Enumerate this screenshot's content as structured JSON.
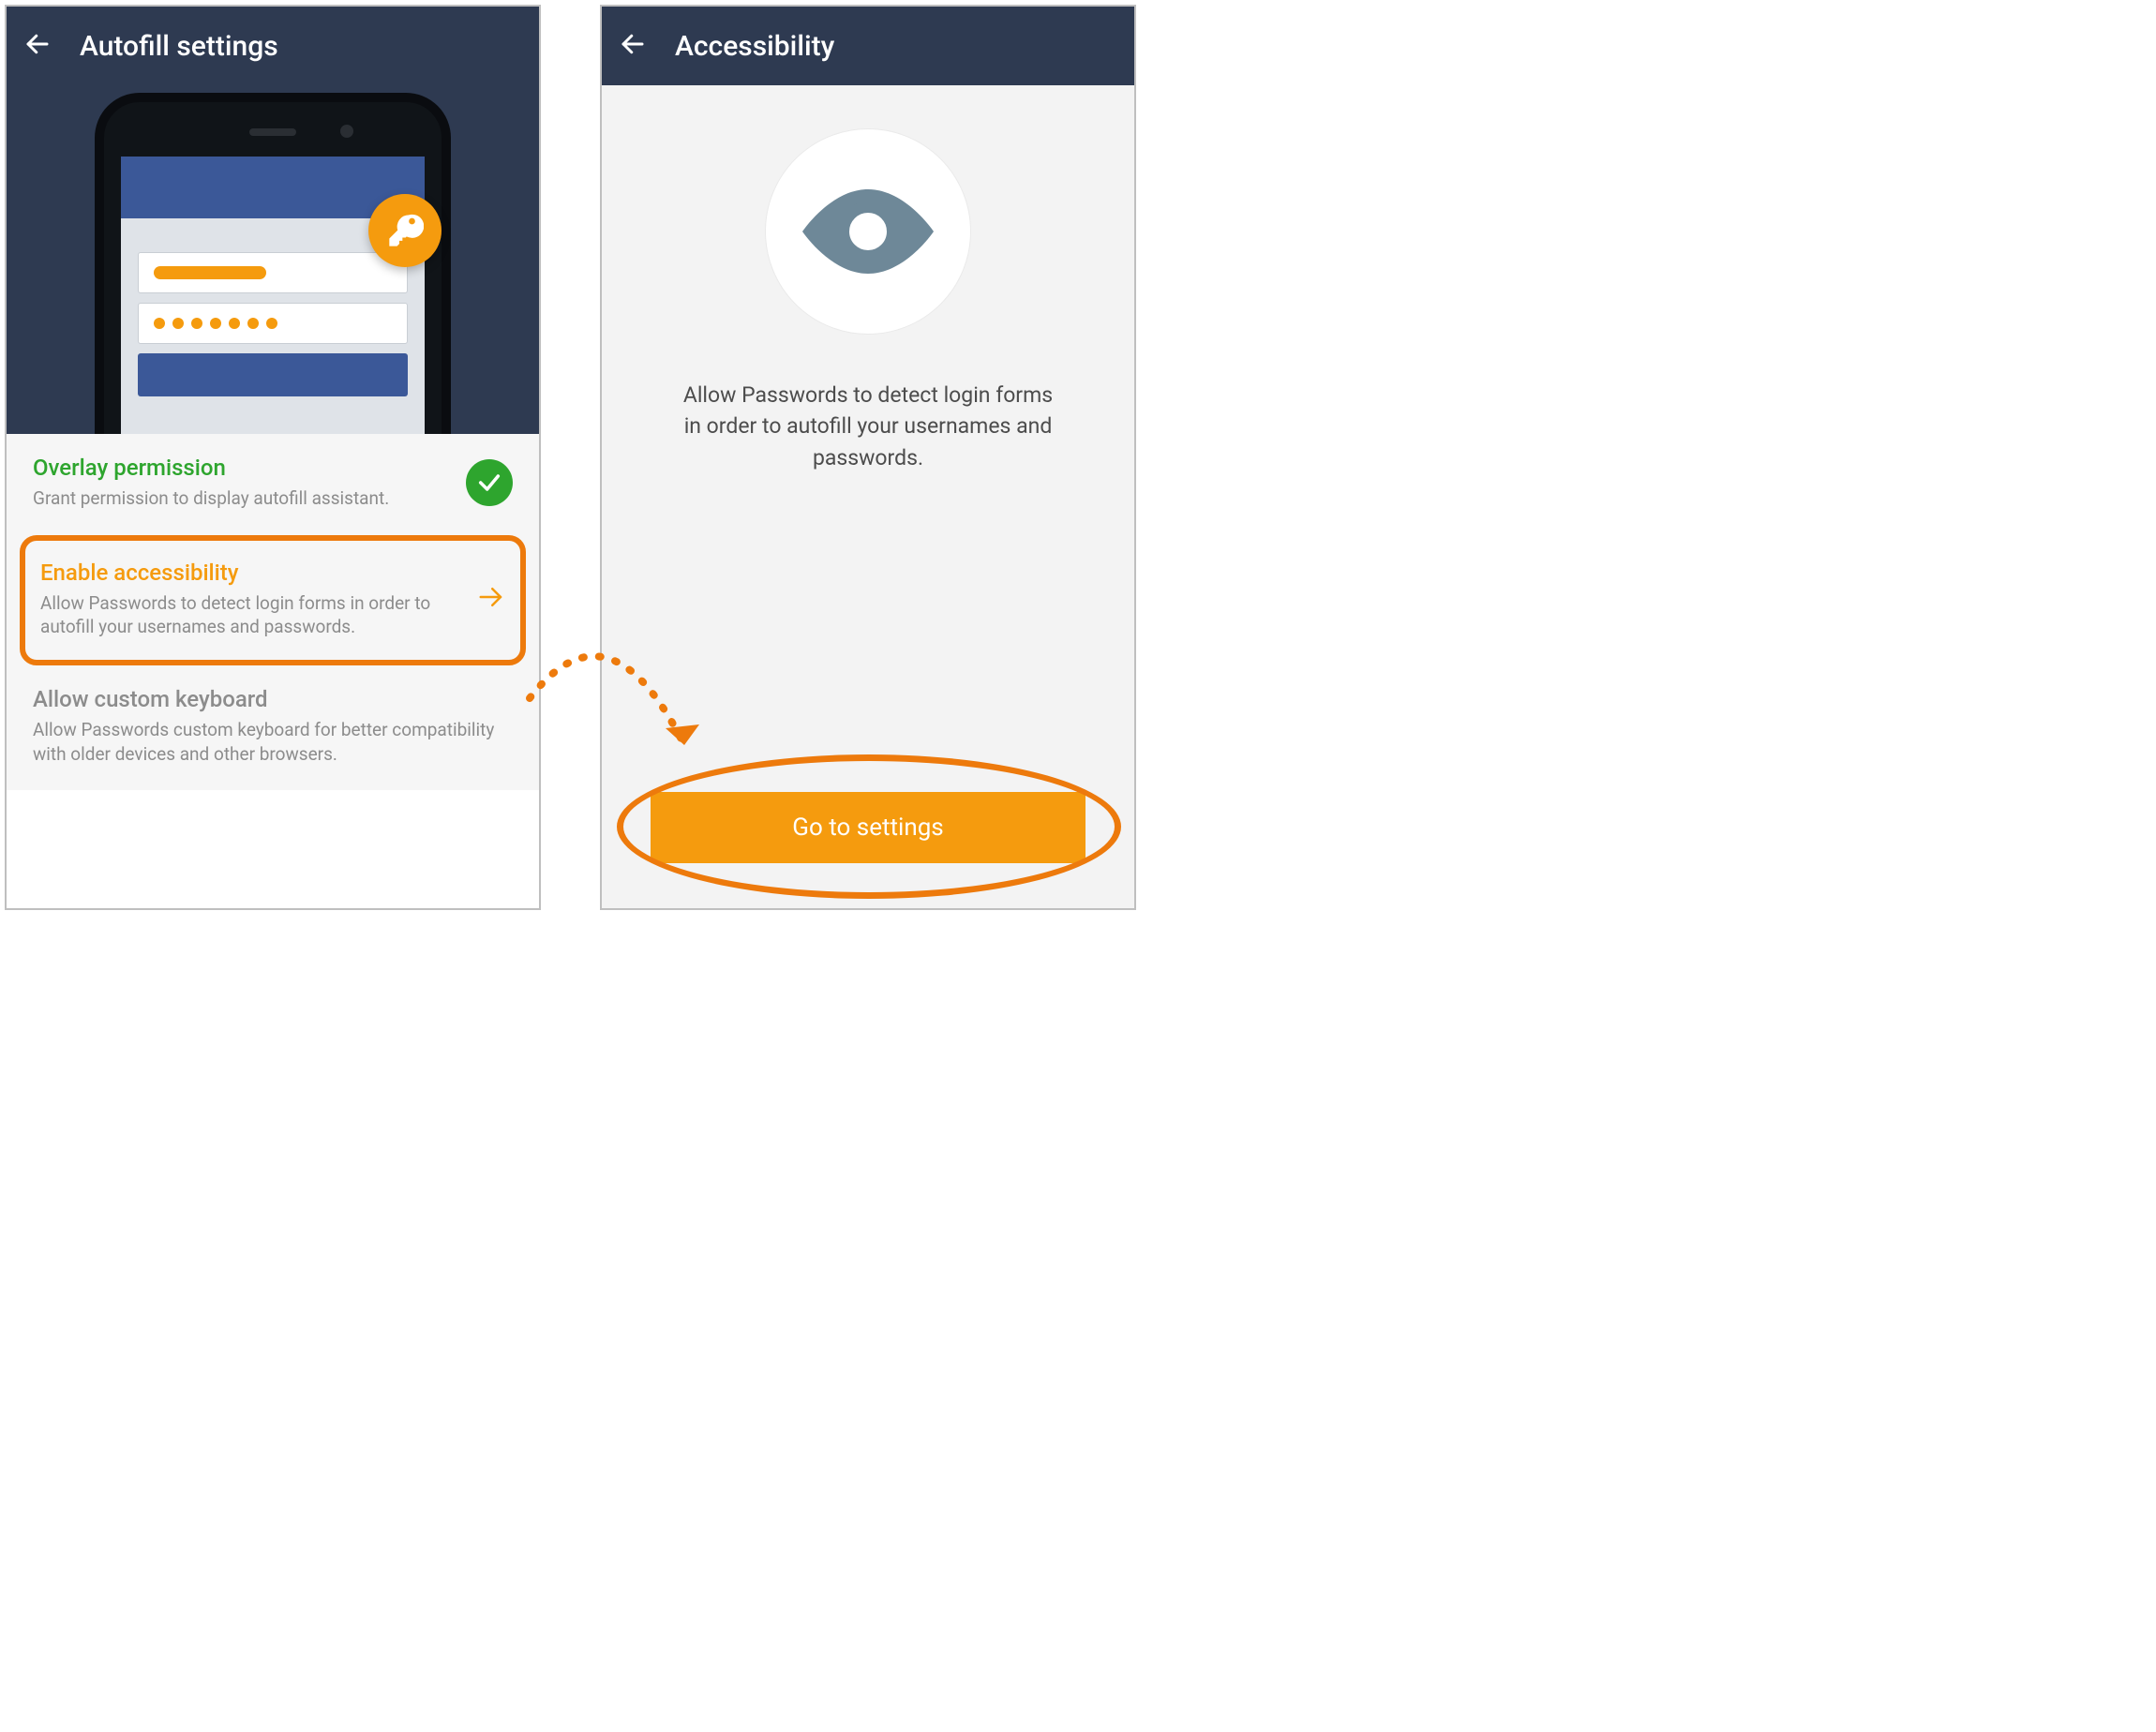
{
  "left": {
    "title": "Autofill settings",
    "settings": [
      {
        "title": "Overlay permission",
        "desc": "Grant permission to display autofill assistant.",
        "status": "granted"
      },
      {
        "title": "Enable accessibility",
        "desc": "Allow Passwords to detect login forms in order to autofill your usernames and passwords.",
        "status": "highlighted"
      },
      {
        "title": "Allow custom keyboard",
        "desc": "Allow Passwords custom keyboard for better compatibility with older devices and other browsers.",
        "status": "none"
      }
    ]
  },
  "right": {
    "title": "Accessibility",
    "desc": "Allow Passwords to detect login forms in order to autofill your usernames and passwords.",
    "button": "Go to settings"
  },
  "colors": {
    "accent_orange": "#f59b0e",
    "highlight_orange": "#ed7a0c",
    "navy": "#2e3a51",
    "green": "#2ea52e"
  }
}
